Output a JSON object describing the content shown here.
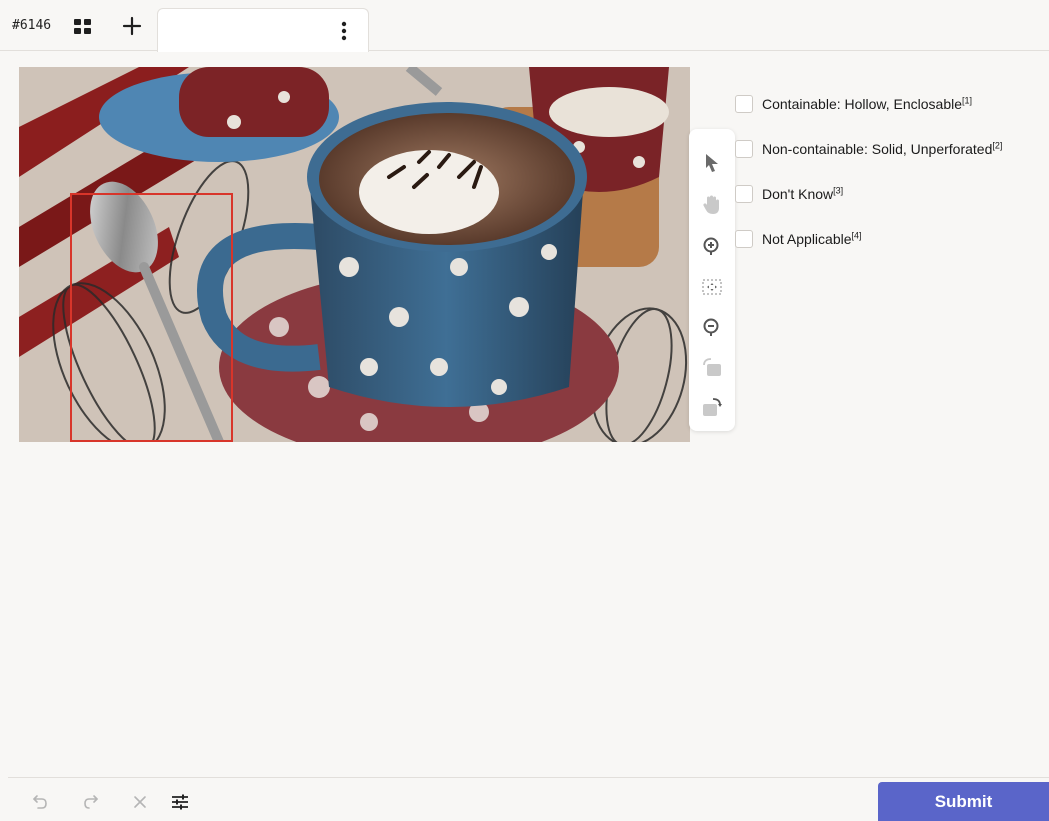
{
  "header": {
    "task_id": "#6146",
    "grid_icon": "grid-icon",
    "add_icon": "plus-icon",
    "tab_title": "",
    "tab_menu_icon": "kebab-menu-icon"
  },
  "image": {
    "bounding_box_color": "#d8352a"
  },
  "toolbar": {
    "tools": [
      {
        "name": "pointer-icon"
      },
      {
        "name": "hand-pan-icon"
      },
      {
        "name": "zoom-in-icon"
      },
      {
        "name": "fit-to-screen-icon"
      },
      {
        "name": "zoom-out-icon"
      },
      {
        "name": "rotate-left-icon"
      },
      {
        "name": "rotate-right-icon"
      }
    ]
  },
  "choices": [
    {
      "label": "Containable: Hollow, Enclosable",
      "hotkey": "[1]",
      "checked": false
    },
    {
      "label": "Non-containable: Solid, Unperforated",
      "hotkey": "[2]",
      "checked": false
    },
    {
      "label": "Don't Know",
      "hotkey": "[3]",
      "checked": false
    },
    {
      "label": "Not Applicable",
      "hotkey": "[4]",
      "checked": false
    }
  ],
  "footer": {
    "undo_icon": "undo-icon",
    "redo_icon": "redo-icon",
    "reset_icon": "close-icon",
    "settings_icon": "sliders-icon",
    "submit_label": "Submit"
  },
  "colors": {
    "accent": "#5a65c9",
    "background": "#f8f7f5"
  }
}
